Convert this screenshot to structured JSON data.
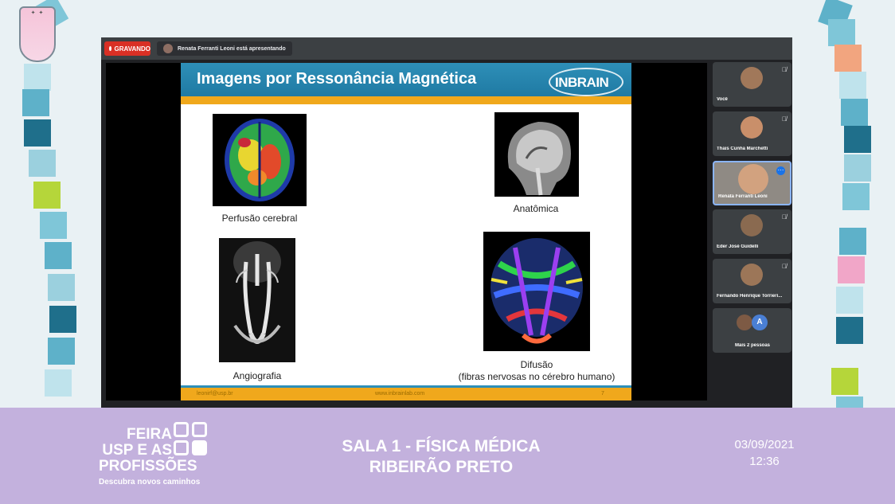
{
  "meeting": {
    "recording_label": "GRAVANDO",
    "presenter_notice": "Renata Ferranti Leoni está apresentando"
  },
  "slide": {
    "title": "Imagens por Ressonância Magnética",
    "logo_text": "INBRAIN",
    "captions": {
      "perfusion": "Perfusão cerebral",
      "anatomy": "Anatômica",
      "angiography": "Angiografia",
      "diffusion_line1": "Difusão",
      "diffusion_line2": "(fibras nervosas no cérebro humano)"
    },
    "footer": {
      "email": "leonirf@usp.br",
      "website": "www.inbrainlab.com",
      "page": "7"
    }
  },
  "participants": [
    {
      "name": "Você",
      "mic": "mic-off-icon"
    },
    {
      "name": "Thais Cunha Marchetti",
      "mic": "mic-off-icon"
    },
    {
      "name": "Renata Ferranti Leoni",
      "mic": "more-icon",
      "active": true
    },
    {
      "name": "Éder José Guidelli",
      "mic": "mic-off-icon"
    },
    {
      "name": "Fernando Henrique Torrieri...",
      "mic": "mic-off-icon"
    }
  ],
  "more_people": {
    "label": "Mais 2 pessoas",
    "avatar_letter": "A"
  },
  "banner": {
    "brand_lines": [
      "FEIRA",
      "USP E AS",
      "PROFISSÕES"
    ],
    "tagline": "Descubra novos caminhos",
    "room_line1": "SALA 1 - FÍSICA MÉDICA",
    "room_line2": "RIBEIRÃO PRETO",
    "date": "03/09/2021",
    "time": "12:36"
  },
  "colors": {
    "slide_header": "#2e8fb8",
    "slide_band": "#f0a81c",
    "banner": "#c3b1dd",
    "recording": "#d93025"
  }
}
